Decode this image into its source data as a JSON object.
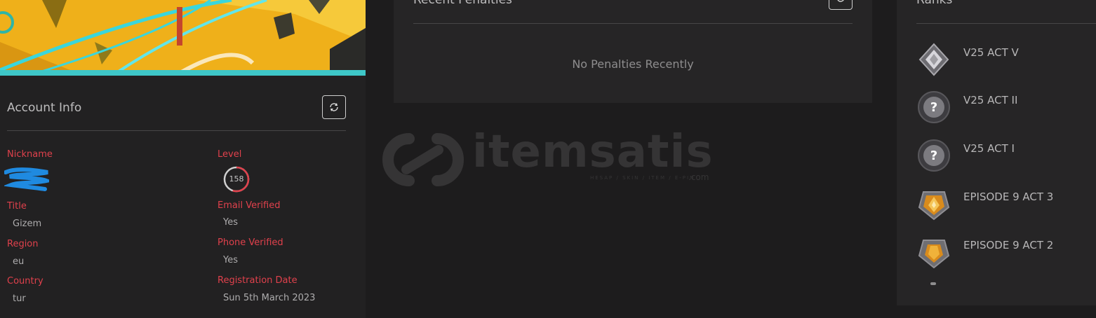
{
  "account": {
    "title": "Account Info",
    "fields_left": [
      {
        "label": "Nickname",
        "value": ""
      },
      {
        "label": "Title",
        "value": "Gizem"
      },
      {
        "label": "Region",
        "value": "eu"
      },
      {
        "label": "Country",
        "value": "tur"
      }
    ],
    "level_label": "Level",
    "level_value": "158",
    "level_progress": 0.55,
    "fields_right": [
      {
        "label": "Email Verified",
        "value": "Yes"
      },
      {
        "label": "Phone Verified",
        "value": "Yes"
      },
      {
        "label": "Registration Date",
        "value": "Sun 5th March 2023"
      }
    ]
  },
  "penalties": {
    "title": "Recent Penalties",
    "empty_text": "No Penalties Recently"
  },
  "ranks": {
    "title": "Ranks",
    "items": [
      {
        "label": "V25 ACT V",
        "icon": "diamond-rank-icon"
      },
      {
        "label": "V25 ACT II",
        "icon": "unknown-rank-icon"
      },
      {
        "label": "V25 ACT I",
        "icon": "unknown-rank-icon"
      },
      {
        "label": "EPISODE 9 ACT 3",
        "icon": "gold-rank-icon"
      },
      {
        "label": "EPISODE 9 ACT 2",
        "icon": "gold-rank-icon"
      }
    ]
  },
  "watermark": {
    "brand": "itemsatis",
    "tagline": "HESAP / SKIN / ITEM / E-PIN",
    "tld": ".com"
  },
  "colors": {
    "label_red": "#e0414c",
    "panel_bg": "#262526",
    "page_bg": "#1d1c1d",
    "banner_yellow": "#f0b41c",
    "banner_cyan": "#3ad6dc"
  }
}
